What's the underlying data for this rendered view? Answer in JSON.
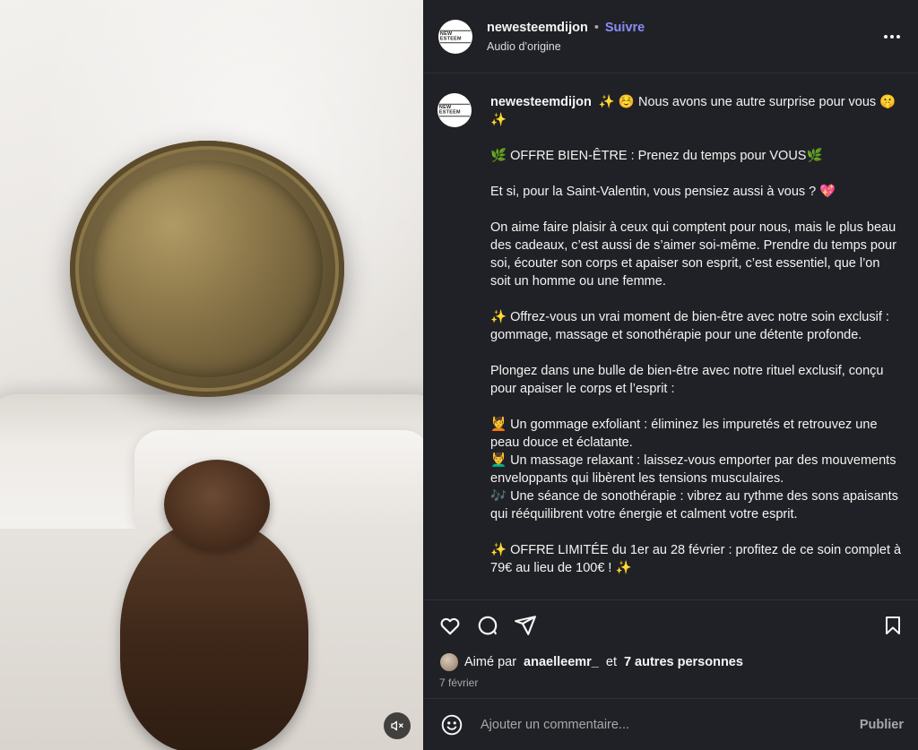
{
  "post": {
    "username": "newesteemdijon",
    "avatar_logo_text": "NEW ESTEEM",
    "separator": "•",
    "follow_label": "Suivre",
    "audio_label": "Audio d’origine"
  },
  "caption": {
    "username": "newesteemdijon",
    "intro": "✨ ☺️ Nous avons une autre surprise pour vous 🤫 ✨",
    "paragraphs": [
      "🌿 OFFRE BIEN-ÊTRE : Prenez du temps pour VOUS🌿",
      "Et si, pour la Saint-Valentin, vous pensiez aussi à vous ? 💖",
      "On aime faire plaisir à ceux qui comptent pour nous, mais le plus beau des cadeaux, c’est aussi de s’aimer soi-même. Prendre du temps pour soi, écouter son corps et apaiser son esprit, c’est essentiel, que l’on soit un homme ou une femme.",
      "✨ Offrez-vous un vrai moment de bien-être avec notre soin exclusif : gommage, massage et sonothérapie pour une détente profonde.",
      "Plongez dans une bulle de bien-être avec notre rituel exclusif, conçu pour apaiser le corps et l’esprit :"
    ],
    "list_items": [
      "💆 Un gommage exfoliant : éliminez les impuretés et retrouvez une peau douce et éclatante.",
      "💆‍♂️ Un massage relaxant : laissez-vous emporter par des mouvements enveloppants qui libèrent les tensions musculaires.",
      "🎶 Une séance de sonothérapie : vibrez au rythme des sons apaisants qui rééquilibrent votre énergie et calment votre esprit."
    ],
    "offer": "✨ OFFRE LIMITÉE du 1er au 28 février : profitez de ce soin complet à 79€ au lieu de 100€ ! ✨"
  },
  "likes": {
    "prefix": "Aimé par",
    "user": "anaelleemr_",
    "conj": "et",
    "others": "7 autres personnes"
  },
  "date": "7 février",
  "comment": {
    "placeholder": "Ajouter un commentaire...",
    "publish_label": "Publier"
  },
  "icons": {
    "like": "heart-icon",
    "comment": "comment-icon",
    "share": "send-icon",
    "save": "bookmark-icon",
    "emoji": "emoji-icon",
    "more": "more-icon",
    "mute": "mute-icon"
  },
  "colors": {
    "panel_bg": "#202126",
    "follow": "#8a8cf7",
    "text": "#f5f5f5",
    "muted": "#a8a8a8"
  }
}
